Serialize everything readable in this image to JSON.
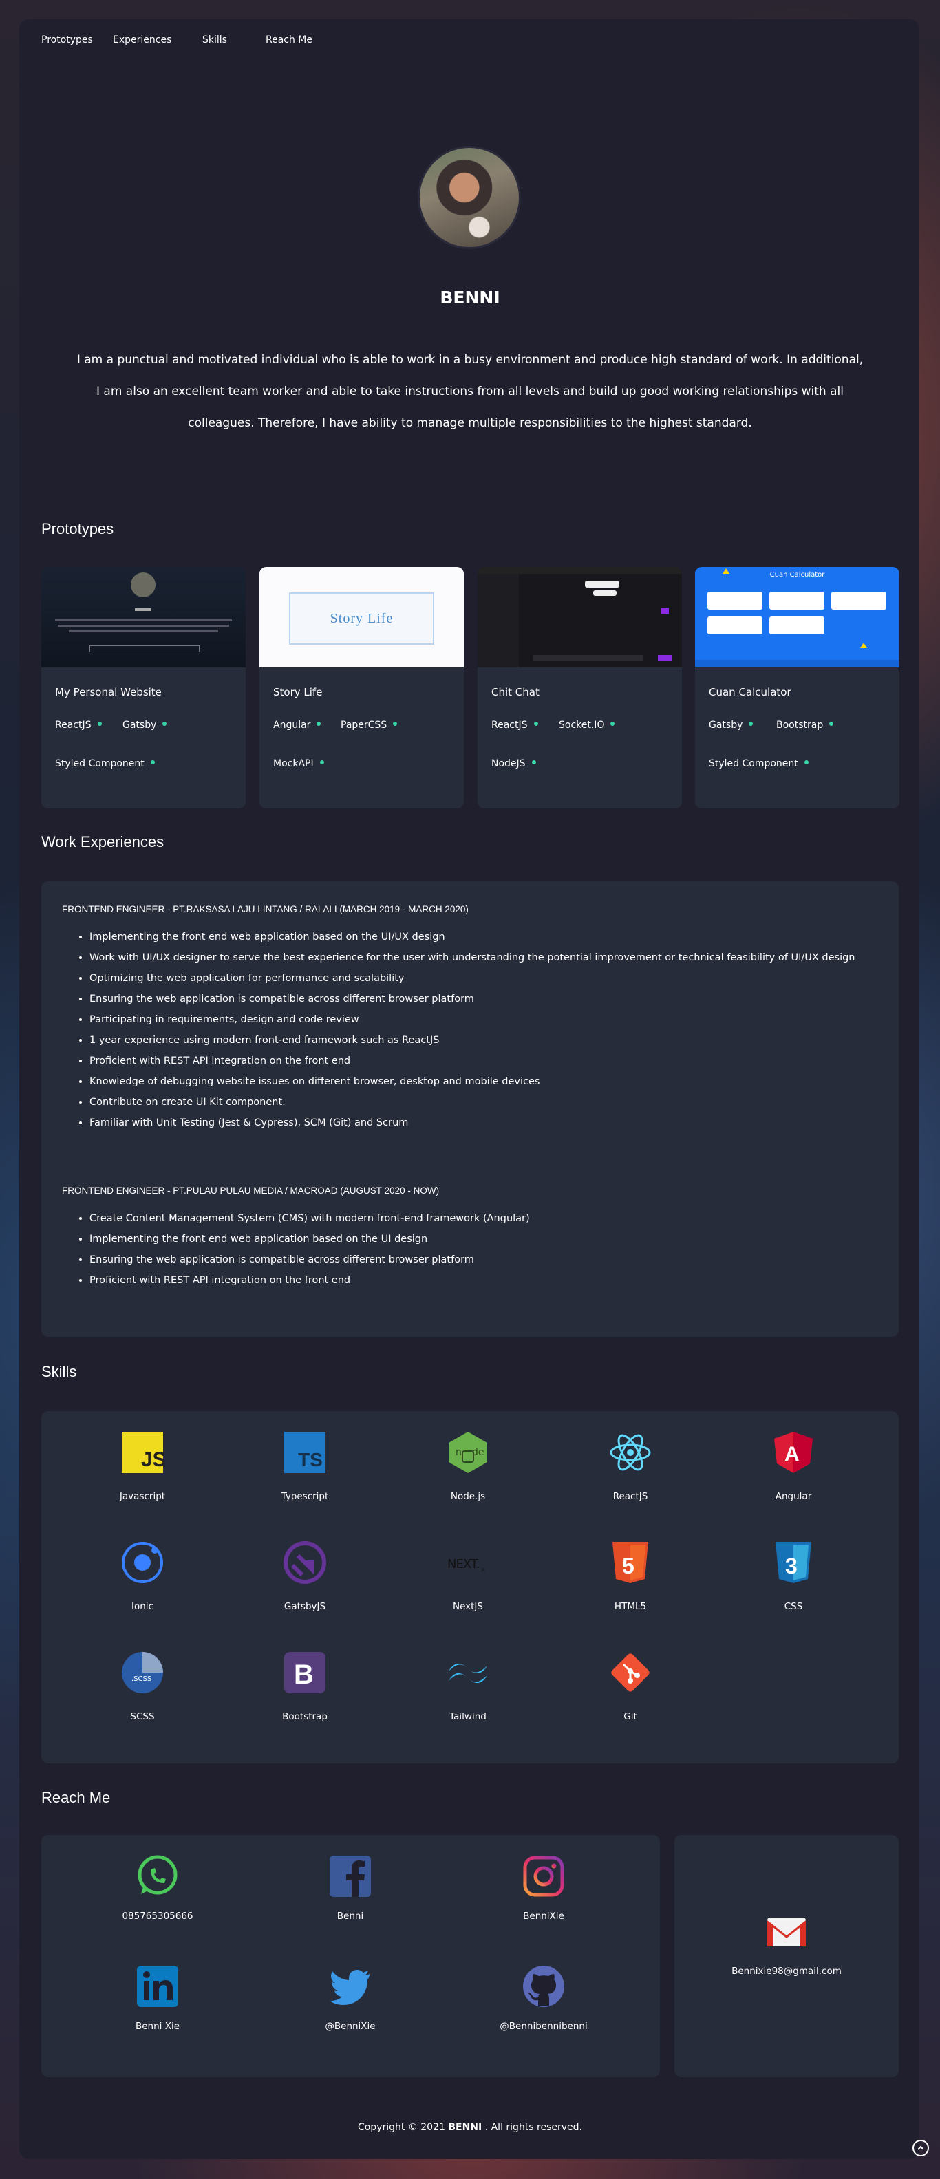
{
  "nav": [
    "Prototypes",
    "Experiences",
    "Skills",
    "Reach Me"
  ],
  "profile": {
    "name": "BENNI",
    "bio_lines": [
      "I am a punctual and motivated individual who is able to work in a busy environment and produce high standard of work. In additional,",
      "I am also an excellent team worker and able to take instructions from all levels and build up good working relationships with all",
      "colleagues. Therefore, I have ability to manage multiple responsibilities to the highest standard."
    ]
  },
  "sections": {
    "prototypes": "Prototypes",
    "experiences": "Work Experiences",
    "skills": "Skills",
    "reach": "Reach Me"
  },
  "projects": [
    {
      "title": "My Personal Website",
      "tags": [
        "ReactJS",
        "Gatsby",
        "Styled Component"
      ]
    },
    {
      "title": "Story Life",
      "tags": [
        "Angular",
        "PaperCSS",
        "MockAPI"
      ],
      "thumb_text": "Story Life"
    },
    {
      "title": "Chit Chat",
      "tags": [
        "ReactJS",
        "Socket.IO",
        "NodeJS"
      ]
    },
    {
      "title": "Cuan Calculator",
      "tags": [
        "Gatsby",
        "Bootstrap",
        "Styled Component"
      ],
      "thumb_text": "Cuan Calculator"
    }
  ],
  "experiences": [
    {
      "role": "FRONTEND ENGINEER - PT.RAKSASA LAJU LINTANG / RALALI (MARCH 2019 - MARCH 2020)",
      "items": [
        "Implementing the front end web application based on the UI/UX design",
        "Work with UI/UX designer to serve the best experience for the user with understanding the potential improvement or technical feasibility of UI/UX design",
        "Optimizing the web application for performance and scalability",
        "Ensuring the web application is compatible across different browser platform",
        "Participating in requirements, design and code review",
        "1 year experience using modern front-end framework such as ReactJS",
        "Proficient with REST API integration on the front end",
        "Knowledge of debugging website issues on different browser, desktop and mobile devices",
        "Contribute on create UI Kit component.",
        "Familiar with Unit Testing (Jest & Cypress), SCM (Git) and Scrum"
      ]
    },
    {
      "role": "FRONTEND ENGINEER - PT.PULAU PULAU MEDIA / MACROAD (AUGUST 2020 - NOW)",
      "items": [
        "Create Content Management System (CMS) with modern front-end framework (Angular)",
        "Implementing the front end web application based on the UI design",
        "Ensuring the web application is compatible across different browser platform",
        "Proficient with REST API integration on the front end"
      ]
    }
  ],
  "skills": [
    {
      "label": "Javascript",
      "icon": "javascript-icon"
    },
    {
      "label": "Typescript",
      "icon": "typescript-icon"
    },
    {
      "label": "Node.js",
      "icon": "nodejs-icon"
    },
    {
      "label": "ReactJS",
      "icon": "react-icon"
    },
    {
      "label": "Angular",
      "icon": "angular-icon"
    },
    {
      "label": "Ionic",
      "icon": "ionic-icon"
    },
    {
      "label": "GatsbyJS",
      "icon": "gatsby-icon"
    },
    {
      "label": "NextJS",
      "icon": "nextjs-icon"
    },
    {
      "label": "HTML5",
      "icon": "html5-icon"
    },
    {
      "label": "CSS",
      "icon": "css3-icon"
    },
    {
      "label": "SCSS",
      "icon": "scss-icon"
    },
    {
      "label": "Bootstrap",
      "icon": "bootstrap-icon"
    },
    {
      "label": "Tailwind",
      "icon": "tailwind-icon"
    },
    {
      "label": "Git",
      "icon": "git-icon"
    }
  ],
  "contacts": [
    {
      "label": "085765305666",
      "icon": "whatsapp-icon"
    },
    {
      "label": "Benni",
      "icon": "facebook-icon"
    },
    {
      "label": "BenniXie",
      "icon": "instagram-icon"
    },
    {
      "label": "Benni Xie",
      "icon": "linkedin-icon"
    },
    {
      "label": "@BenniXie",
      "icon": "twitter-icon"
    },
    {
      "label": "@Bennibennibenni",
      "icon": "github-icon"
    }
  ],
  "email": {
    "label": "Bennixie98@gmail.com",
    "icon": "gmail-icon"
  },
  "footer": {
    "prefix": "Copyright © 2021",
    "name": "BENNI",
    "suffix": ". All rights reserved."
  },
  "colors": {
    "accent_dot": "#3ad6a8",
    "card": "#272c3b",
    "frame": "#1f1f2e"
  }
}
